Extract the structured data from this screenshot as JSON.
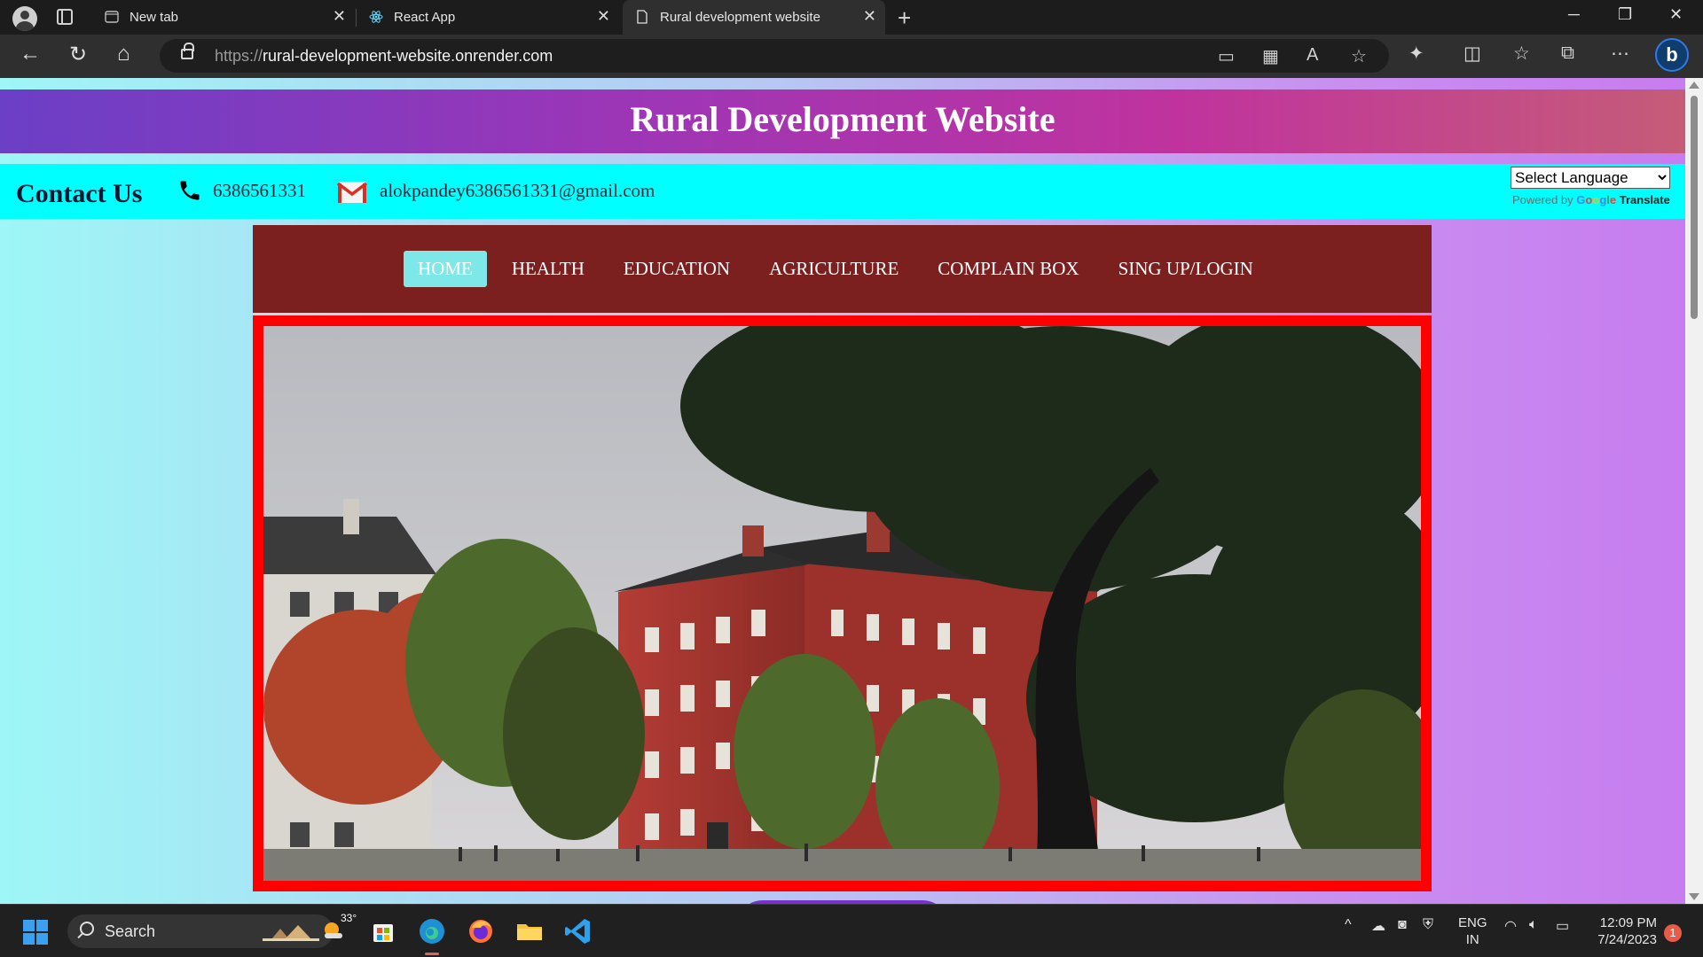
{
  "browser": {
    "tabs": [
      {
        "title": "New tab",
        "icon": "new-tab-page-icon",
        "active": false
      },
      {
        "title": "React App",
        "icon": "react-logo-icon",
        "active": false
      },
      {
        "title": "Rural development website",
        "icon": "page-icon",
        "active": true
      }
    ],
    "url_prefix": "https://",
    "url_host": "rural-development-website.onrender.com"
  },
  "site": {
    "title": "Rural Development Website",
    "contact": {
      "label": "Contact Us",
      "phone": "6386561331",
      "email": "alokpandey6386561331@gmail.com"
    },
    "translate": {
      "select_label": "Select Language",
      "powered_by": "Powered by",
      "google": "Google",
      "translate": "Translate"
    },
    "nav": [
      {
        "label": "HOME",
        "active": true
      },
      {
        "label": "HEALTH",
        "active": false
      },
      {
        "label": "EDUCATION",
        "active": false
      },
      {
        "label": "AGRICULTURE",
        "active": false
      },
      {
        "label": "COMPLAIN BOX",
        "active": false
      },
      {
        "label": "SING UP/LOGIN",
        "active": false
      }
    ],
    "hero_image": "red-brick-campus-building-with-trees",
    "colors": {
      "header_gradient": [
        "#6b3fc6",
        "#c0339e",
        "#c55c78"
      ],
      "contact_bar": "#00ffff",
      "navbar": "#7b1f1f",
      "nav_active": "#7ee8e8",
      "hero_border": "#ff0000"
    }
  },
  "taskbar": {
    "search_label": "Search",
    "weather_temp": "33°",
    "language": {
      "line1": "ENG",
      "line2": "IN"
    },
    "time": "12:09 PM",
    "date": "7/24/2023",
    "notification_count": "1"
  }
}
